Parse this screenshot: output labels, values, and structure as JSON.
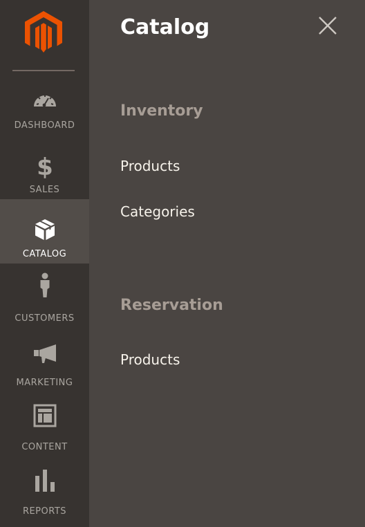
{
  "colors": {
    "sidebar_bg": "#373330",
    "sidebar_active_bg": "#524d49",
    "panel_bg": "#4a4542",
    "brand_orange": "#eb5202",
    "label_muted": "#aaa6a0",
    "section_title": "#a79d95",
    "link_text": "#f7f3eb"
  },
  "logo": {
    "icon": "magento-logo-icon"
  },
  "sidebar": {
    "items": [
      {
        "label": "DASHBOARD",
        "icon": "dashboard-gauge-icon",
        "active": false
      },
      {
        "label": "SALES",
        "icon": "dollar-icon",
        "active": false
      },
      {
        "label": "CATALOG",
        "icon": "cube-box-icon",
        "active": true
      },
      {
        "label": "CUSTOMERS",
        "icon": "person-icon",
        "active": false
      },
      {
        "label": "MARKETING",
        "icon": "megaphone-icon",
        "active": false
      },
      {
        "label": "CONTENT",
        "icon": "layout-icon",
        "active": false
      },
      {
        "label": "REPORTS",
        "icon": "bar-chart-icon",
        "active": false
      }
    ]
  },
  "panel": {
    "title": "Catalog",
    "close_icon": "close-icon",
    "sections": [
      {
        "title": "Inventory",
        "links": [
          "Products",
          "Categories"
        ]
      },
      {
        "title": "Reservation",
        "links": [
          "Products"
        ]
      }
    ]
  }
}
